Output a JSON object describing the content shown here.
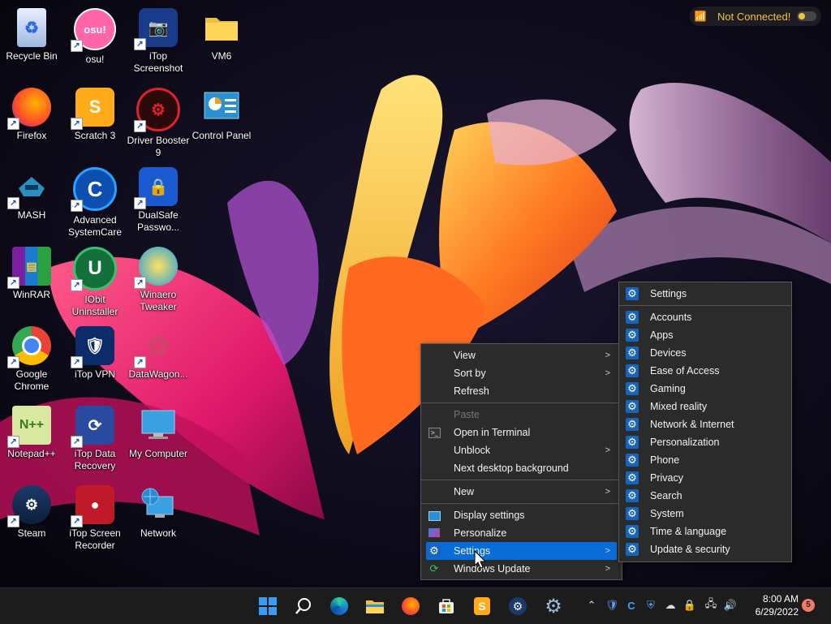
{
  "desktop": {
    "icons": [
      {
        "label": "Recycle Bin"
      },
      {
        "label": "osu!",
        "glyph": "osu!"
      },
      {
        "label": "iTop\nScreenshot"
      },
      {
        "label": "VM6"
      },
      {
        "label": "Firefox"
      },
      {
        "label": "Scratch 3"
      },
      {
        "label": "Driver Booster\n9"
      },
      {
        "label": "Control Panel"
      },
      {
        "label": "MASH"
      },
      {
        "label": "Advanced\nSystemCare",
        "glyph": "C"
      },
      {
        "label": "DualSafe\nPasswo..."
      },
      {
        "label": "WinRAR"
      },
      {
        "label": "IObit\nUninstaller",
        "glyph": "U"
      },
      {
        "label": "Winaero\nTweaker"
      },
      {
        "label": "Google\nChrome"
      },
      {
        "label": "iTop VPN"
      },
      {
        "label": "DataWagon..."
      },
      {
        "label": "Notepad++"
      },
      {
        "label": "iTop Data\nRecovery"
      },
      {
        "label": "My Computer"
      },
      {
        "label": "Steam"
      },
      {
        "label": "iTop Screen\nRecorder"
      },
      {
        "label": "Network"
      }
    ]
  },
  "network_widget": {
    "status": "Not Connected!"
  },
  "context_menu": {
    "view": "View",
    "sort_by": "Sort by",
    "refresh": "Refresh",
    "paste": "Paste",
    "open_terminal": "Open in Terminal",
    "unblock": "Unblock",
    "next_background": "Next desktop background",
    "new": "New",
    "display_settings": "Display settings",
    "personalize": "Personalize",
    "settings": "Settings",
    "windows_update": "Windows Update"
  },
  "settings_submenu": {
    "header": "Settings",
    "items": [
      "Accounts",
      "Apps",
      "Devices",
      "Ease of Access",
      "Gaming",
      "Mixed reality",
      "Network & Internet",
      "Personalization",
      "Phone",
      "Privacy",
      "Search",
      "System",
      "Time & language",
      "Update & security"
    ]
  },
  "taskbar": {
    "time": "8:00 AM",
    "date": "6/29/2022",
    "notification_count": "5"
  },
  "colors": {
    "menu_bg": "#2b2b2b",
    "highlight": "#0a6cd6",
    "taskbar_bg": "#1c1c1c",
    "widget_text": "#f0c33c"
  }
}
